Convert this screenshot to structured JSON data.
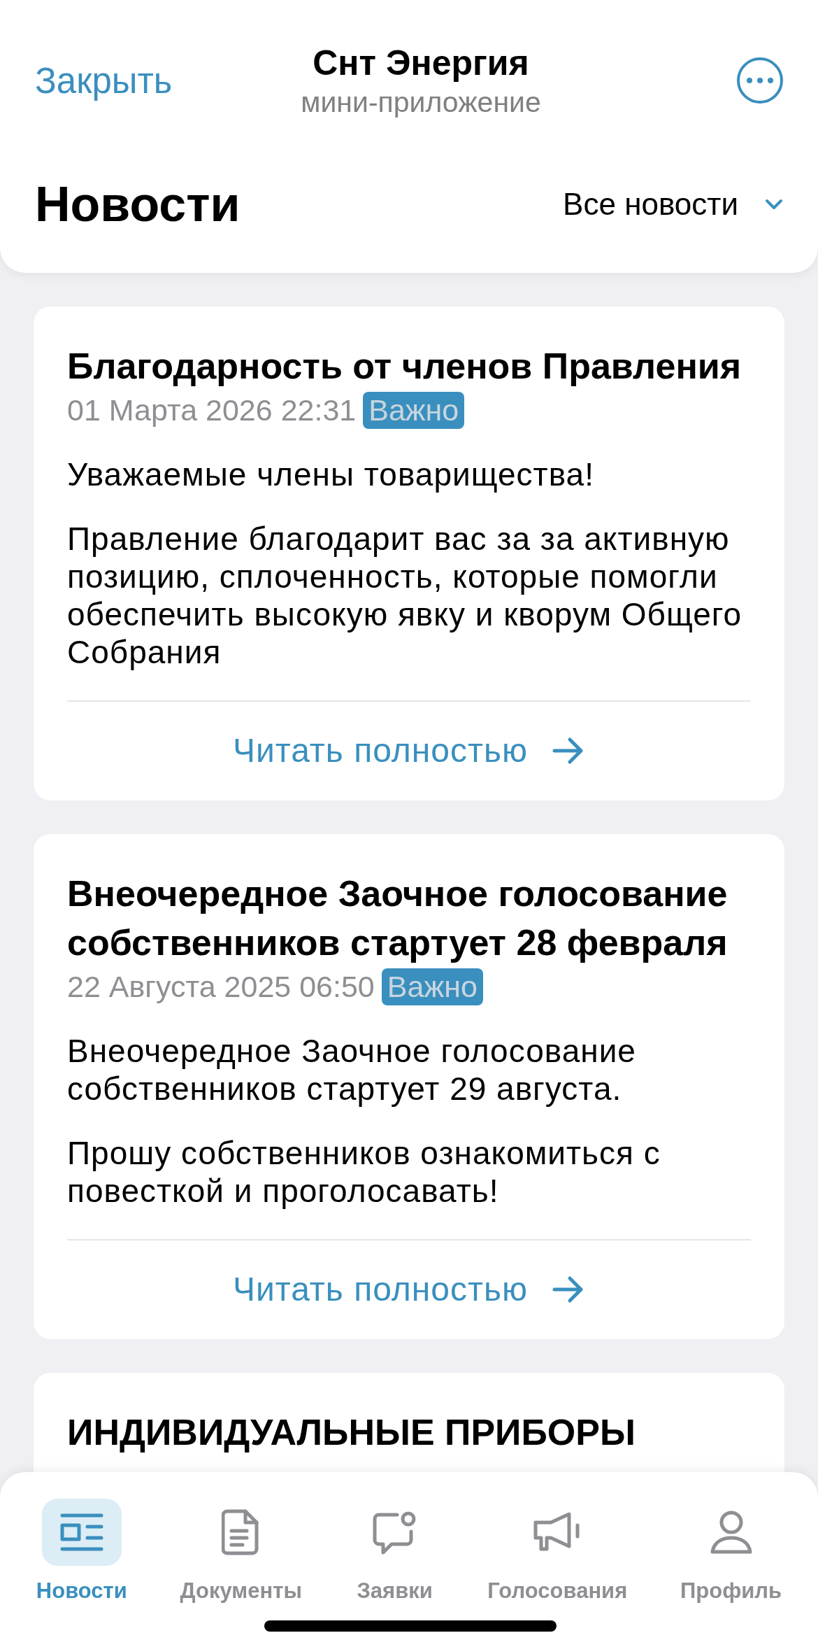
{
  "top_bar": {
    "close": "Закрыть",
    "title": "Снт Энергия",
    "subtitle": "мини-приложение"
  },
  "header": {
    "title": "Новости",
    "filter": "Все новости"
  },
  "news": [
    {
      "title": "Благодарность от членов Правления",
      "date": "01 Марта 2026 22:31",
      "badge": "Важно",
      "paragraphs": [
        "Уважаемые члены товарищества!",
        "Правление благодарит вас за за активную позицию, сплоченность, которые помогли обеспечить высокую явку и кворум Общего Собрания"
      ],
      "read_more": "Читать полностью"
    },
    {
      "title": "Внеочередное Заочное голосование собственников стартует 28 февраля",
      "date": "22 Августа 2025 06:50",
      "badge": "Важно",
      "paragraphs": [
        "Внеочередное Заочное голосование собственников стартует 29 августа.",
        "Прошу собственников ознакомиться с повесткой и проголосавать!"
      ],
      "read_more": "Читать полностью"
    },
    {
      "title": "ИНДИВИДУАЛЬНЫЕ ПРИБОРЫ"
    }
  ],
  "tabs": [
    {
      "label": "Новости",
      "selected": true
    },
    {
      "label": "Документы",
      "selected": false
    },
    {
      "label": "Заявки",
      "selected": false
    },
    {
      "label": "Голосования",
      "selected": false
    },
    {
      "label": "Профиль",
      "selected": false
    }
  ]
}
